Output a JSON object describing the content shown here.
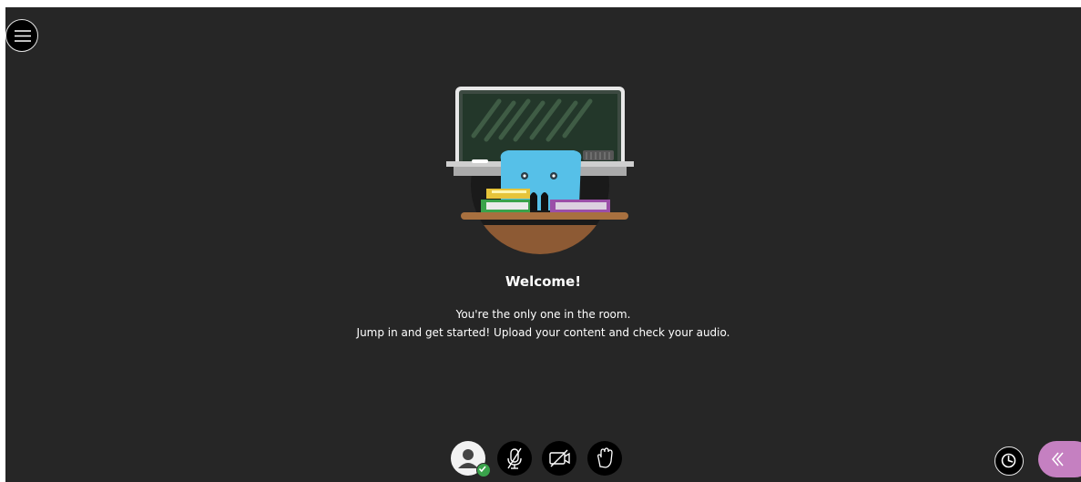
{
  "welcome": {
    "title": "Welcome!",
    "line1": "You're the only one in the room.",
    "line2": "Jump in and get started! Upload your content and check your audio."
  },
  "icons": {
    "menu": "hamburger-menu-icon",
    "illustration": "classroom-illustration",
    "avatar": "user-avatar-icon",
    "status": "check-status-icon",
    "microphone": "microphone-off-icon",
    "camera": "camera-off-icon",
    "hand": "raise-hand-icon",
    "activity": "activity-clock-icon",
    "collaborate": "chevrons-left-icon"
  },
  "colors": {
    "background": "#262626",
    "accent": "#c580c1",
    "status": "#3aa34b"
  }
}
